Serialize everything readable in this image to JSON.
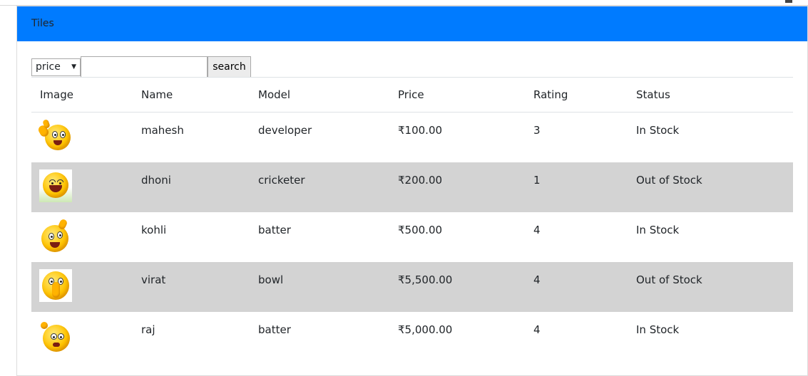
{
  "card": {
    "title": "Tiles"
  },
  "toolbar": {
    "filter_selected": "price",
    "search_value": "",
    "search_placeholder": "",
    "search_label": "search"
  },
  "table": {
    "headers": [
      "Image",
      "Name",
      "Model",
      "Price",
      "Rating",
      "Status"
    ],
    "rows": [
      {
        "image_icon": "thumbs-up-emoji-icon",
        "name": "mahesh",
        "model": "developer",
        "price": "₹100.00",
        "rating": "3",
        "status": "In Stock"
      },
      {
        "image_icon": "laughing-emoji-icon",
        "name": "dhoni",
        "model": "cricketer",
        "price": "₹200.00",
        "rating": "1",
        "status": "Out of Stock"
      },
      {
        "image_icon": "thinking-emoji-icon",
        "name": "kohli",
        "model": "batter",
        "price": "₹500.00",
        "rating": "4",
        "status": "In Stock"
      },
      {
        "image_icon": "shushing-emoji-icon",
        "name": "virat",
        "model": "bowl",
        "price": "₹5,500.00",
        "rating": "4",
        "status": "Out of Stock"
      },
      {
        "image_icon": "dizzy-emoji-icon",
        "name": "raj",
        "model": "batter",
        "price": "₹5,000.00",
        "rating": "4",
        "status": "In Stock"
      }
    ]
  },
  "colors": {
    "header_bg": "#007bff",
    "stripe_bg": "#d3d3d3"
  }
}
